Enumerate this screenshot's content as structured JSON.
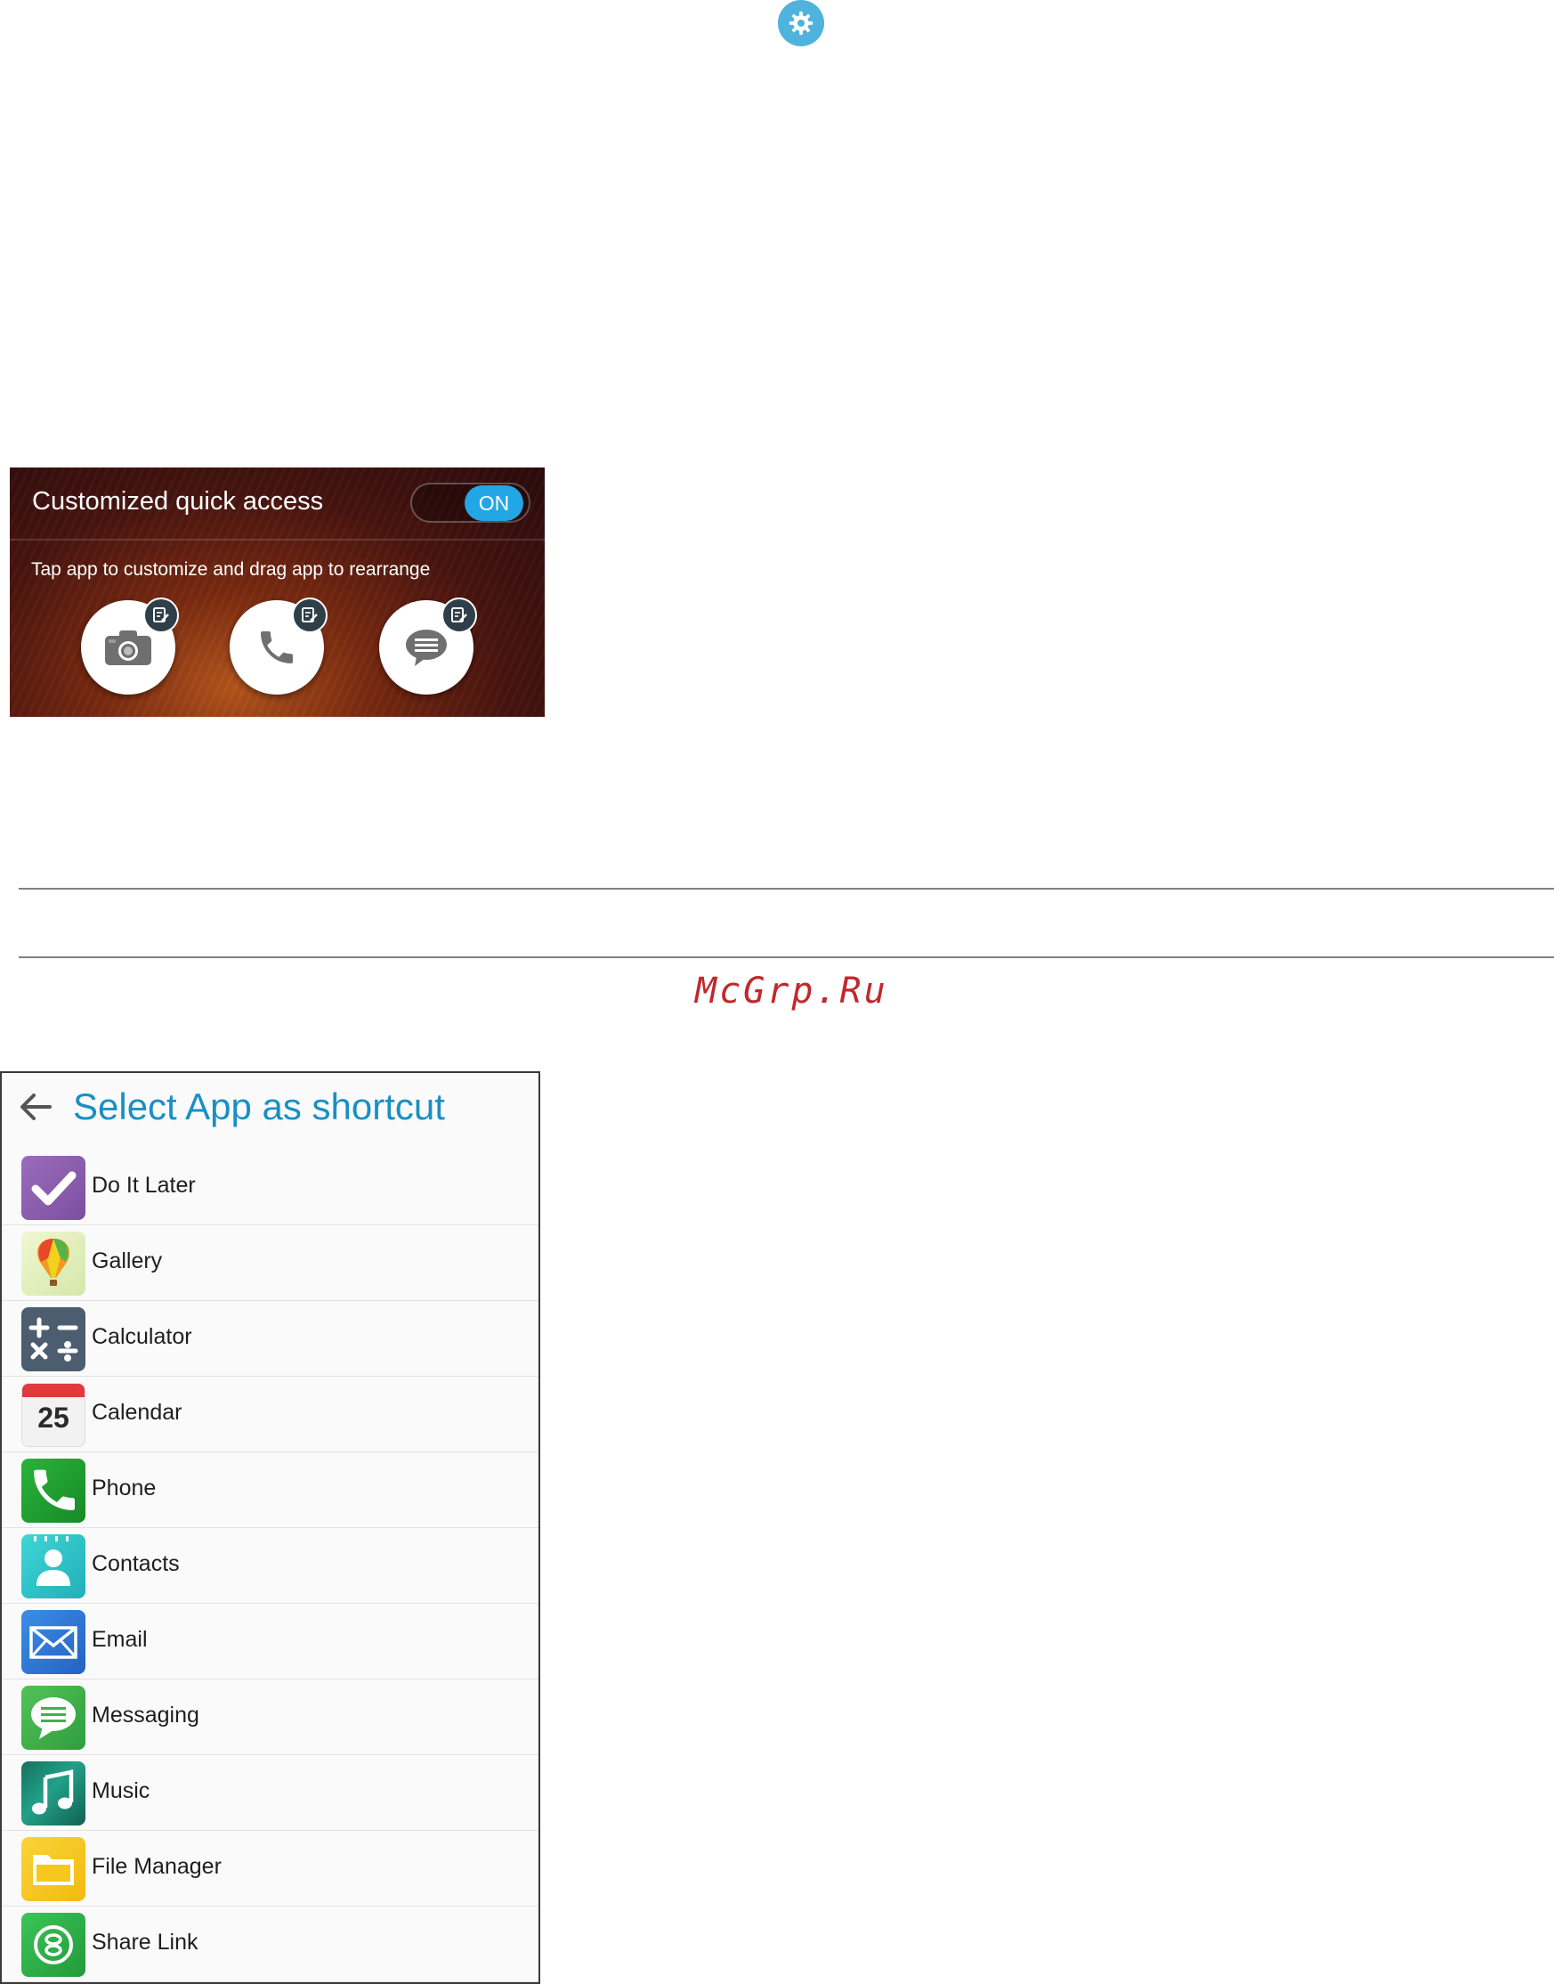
{
  "quick_access": {
    "title": "Customized quick access",
    "toggle_label": "ON",
    "subtitle": "Tap app to customize and drag app to rearrange",
    "apps": [
      {
        "icon": "camera-icon"
      },
      {
        "icon": "phone-icon"
      },
      {
        "icon": "message-icon"
      }
    ]
  },
  "watermark": "McGrp.Ru",
  "select_app": {
    "title": "Select App as shortcut",
    "apps": [
      {
        "label": "Do It Later",
        "icon": "do-it-later-icon",
        "color": "#8e5fae"
      },
      {
        "label": "Gallery",
        "icon": "gallery-icon",
        "color": "#e6f0bf"
      },
      {
        "label": "Calculator",
        "icon": "calculator-icon",
        "color": "#4b5d6e"
      },
      {
        "label": "Calendar",
        "icon": "calendar-icon",
        "color": "#f2f2f2",
        "day": "25"
      },
      {
        "label": "Phone",
        "icon": "phone-icon",
        "color": "#1f9e2f"
      },
      {
        "label": "Contacts",
        "icon": "contacts-icon",
        "color": "#2cc7c9"
      },
      {
        "label": "Email",
        "icon": "email-icon",
        "color": "#2f7ed8"
      },
      {
        "label": "Messaging",
        "icon": "messaging-icon",
        "color": "#3eb24a"
      },
      {
        "label": "Music",
        "icon": "music-icon",
        "color": "#1a8a78"
      },
      {
        "label": "File Manager",
        "icon": "file-manager-icon",
        "color": "#f6c81e"
      },
      {
        "label": "Share Link",
        "icon": "share-link-icon",
        "color": "#2eb54a"
      }
    ]
  },
  "colors": {
    "accent": "#1a8fc4",
    "toggle_on": "#23a6e5",
    "watermark": "#c0292b"
  }
}
